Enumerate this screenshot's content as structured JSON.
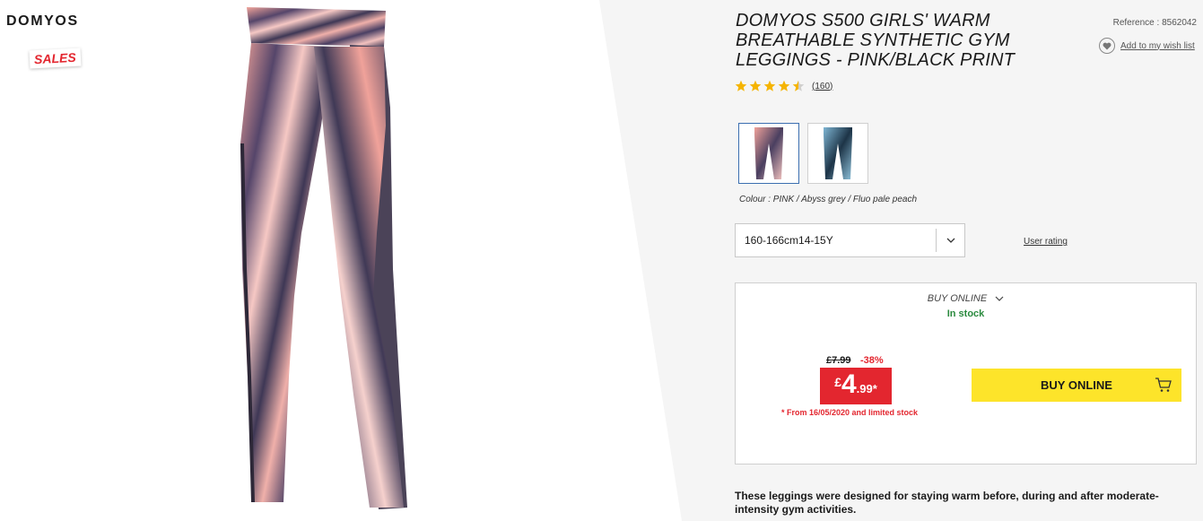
{
  "brand": {
    "logo_text": "DOMYOS",
    "sales_label": "SALES"
  },
  "product": {
    "title": "DOMYOS S500 GIRLS' WARM BREATHABLE SYNTHETIC GYM LEGGINGS - PINK/BLACK PRINT",
    "reference": "Reference : 8562042",
    "wishlist_label": "Add to my wish list",
    "rating": {
      "stars": 4.5,
      "max": 5,
      "review_count": "(160)",
      "star_color": "#f5b400"
    },
    "colour_label": "Colour : PINK / Abyss grey / Fluo pale peach",
    "thumbnails": [
      {
        "name": "pink-black-print",
        "selected": true
      },
      {
        "name": "blue-print",
        "selected": false
      }
    ],
    "size": {
      "selected": "160-166cm14-15Y"
    },
    "user_rating_link": "User rating",
    "description": "These leggings were designed for staying warm before, during and after moderate-intensity gym activities."
  },
  "purchase": {
    "channel": "BUY ONLINE",
    "stock": "In stock",
    "old_price": "£7.99",
    "discount": "-38%",
    "price_currency": "£",
    "price_int": "4",
    "price_dec": ".99*",
    "price_note": "* From 16/05/2020 and limited stock",
    "buy_button": "BUY ONLINE"
  },
  "colors": {
    "accent_red": "#e3262f",
    "buy_yellow": "#fde42a",
    "in_stock_green": "#2a8a3e",
    "selected_border": "#3c6fb0"
  },
  "icons": [
    "heart-icon",
    "star-icon",
    "chevron-down-icon",
    "cart-icon"
  ]
}
